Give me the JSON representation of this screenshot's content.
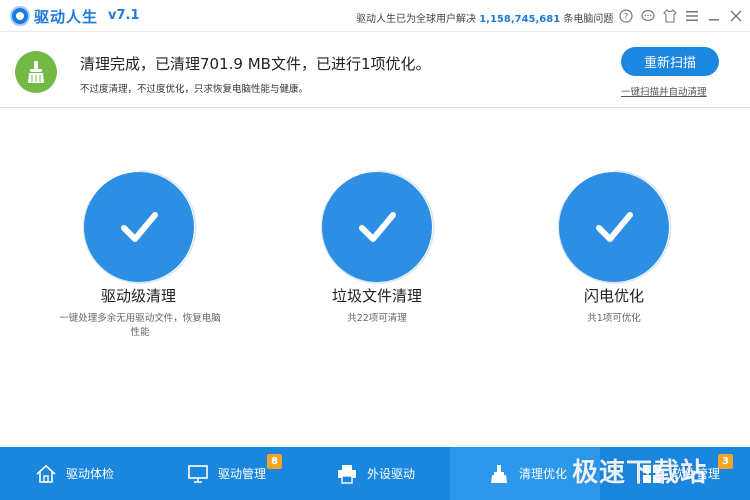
{
  "titlebar": {
    "app_name": "驱动人生",
    "version": "v7.1",
    "stats_prefix": "驱动人生已为全球用户解决",
    "stats_number": "1,158,745,681",
    "stats_suffix": "条电脑问题",
    "buttons": [
      {
        "name": "help-icon"
      },
      {
        "name": "feedback-icon"
      },
      {
        "name": "skin-icon"
      },
      {
        "name": "menu-icon"
      },
      {
        "name": "minimize-icon"
      },
      {
        "name": "close-icon"
      }
    ]
  },
  "header": {
    "headline": "清理完成，已清理701.9 MB文件，已进行1项优化。",
    "subline": "不过度清理，不过度优化，只求恢复电脑性能与健康。",
    "rescan_label": "重新扫描",
    "auto_clean_link": "一键扫描并自动清理",
    "icon": "broom-icon"
  },
  "results": [
    {
      "title": "驱动级清理",
      "desc": "一键处理多余无用驱动文件，恢复电脑性能",
      "icon": "checkmark-icon"
    },
    {
      "title": "垃圾文件清理",
      "desc": "共22项可清理",
      "icon": "checkmark-icon"
    },
    {
      "title": "闪电优化",
      "desc": "共1项可优化",
      "icon": "checkmark-icon"
    }
  ],
  "nav": {
    "items": [
      {
        "label": "驱动体检",
        "icon": "home-icon",
        "active": false
      },
      {
        "label": "驱动管理",
        "icon": "monitor-icon",
        "badge": "8",
        "active": false
      },
      {
        "label": "外设驱动",
        "icon": "printer-icon",
        "active": false
      },
      {
        "label": "清理优化",
        "icon": "broom-icon",
        "active": true
      },
      {
        "label": "软件管理",
        "icon": "apps-icon",
        "badge": "3",
        "active": false
      }
    ]
  },
  "watermark": "极速下载站",
  "colors": {
    "primary": "#1b86de",
    "circle": "#2d8fe4",
    "broom_bg": "#74b945",
    "badge": "#f3a52b"
  }
}
